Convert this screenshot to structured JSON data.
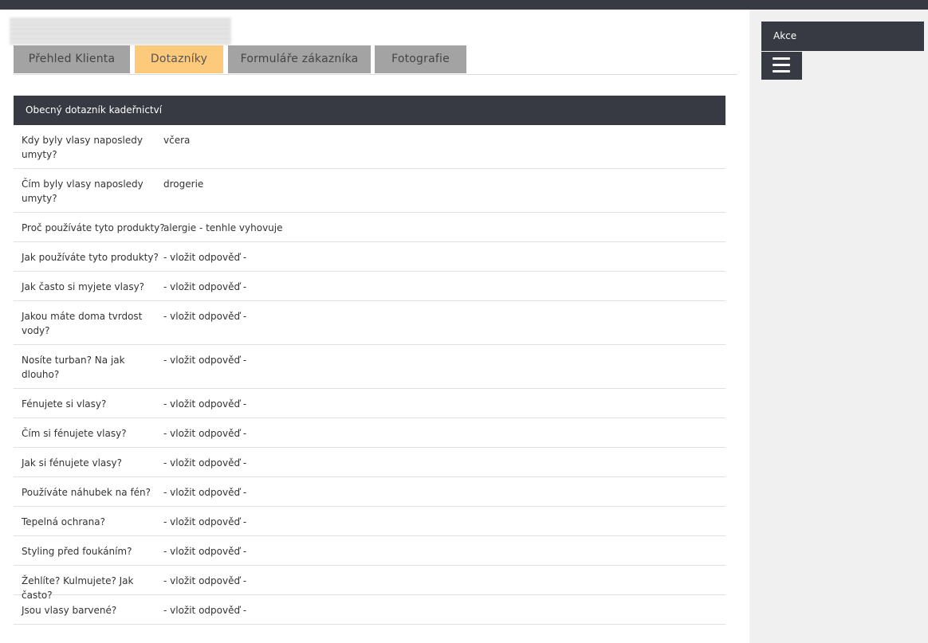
{
  "tabs": [
    {
      "label": "Přehled Klienta"
    },
    {
      "label": "Dotazníky"
    },
    {
      "label": "Formuláře zákazníka"
    },
    {
      "label": "Fotografie"
    }
  ],
  "active_tab_index": 1,
  "active_tab_color": "#fdc97b",
  "questionnaire": {
    "title": "Obecný dotazník kadeřnictví",
    "rows": [
      {
        "question": "Kdy byly vlasy naposledy umyty?",
        "answer": "včera"
      },
      {
        "question": "Čím byly vlasy naposledy umyty?",
        "answer": "drogerie"
      },
      {
        "question": "Proč používáte tyto produkty?",
        "answer": "alergie - tenhle vyhovuje"
      },
      {
        "question": "Jak používáte tyto produkty?",
        "answer": "- vložit odpověď -"
      },
      {
        "question": "Jak často si myjete vlasy?",
        "answer": "- vložit odpověď -"
      },
      {
        "question": "Jakou máte doma tvrdost vody?",
        "answer": "- vložit odpověď -"
      },
      {
        "question": "Nosíte turban? Na jak dlouho?",
        "answer": "- vložit odpověď -"
      },
      {
        "question": "Fénujete si vlasy?",
        "answer": "- vložit odpověď -"
      },
      {
        "question": "Čím si fénujete vlasy?",
        "answer": "- vložit odpověď -"
      },
      {
        "question": "Jak si fénujete vlasy?",
        "answer": "- vložit odpověď -"
      },
      {
        "question": "Používáte náhubek na fén?",
        "answer": "- vložit odpověď -"
      },
      {
        "question": "Tepelná ochrana?",
        "answer": "- vložit odpověď -"
      },
      {
        "question": "Styling před foukáním?",
        "answer": "- vložit odpověď -"
      },
      {
        "question": "Žehlíte? Kulmujete? Jak často?",
        "answer": "- vložit odpověď -"
      },
      {
        "question": "Jsou vlasy barvené?",
        "answer": "- vložit odpověď -"
      }
    ]
  },
  "sidebar": {
    "actions_label": "Akce",
    "menu_icon": "hamburger-menu-icon"
  },
  "colors": {
    "dark_header": "#373a42",
    "inactive_tab": "#a3a3a3",
    "sidebar_bg": "#f0f0f0"
  }
}
